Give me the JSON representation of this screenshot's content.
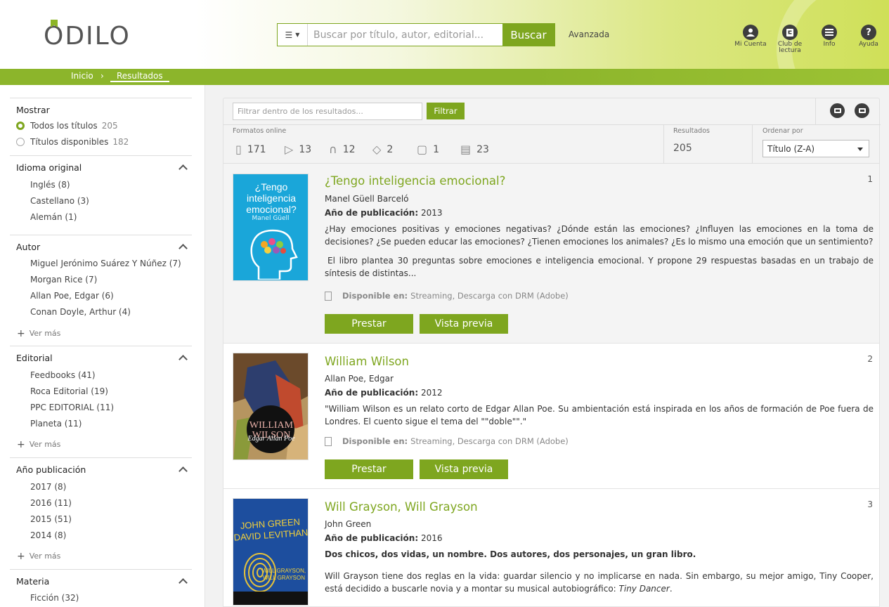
{
  "header": {
    "logo": "ODILO",
    "search": {
      "filter_icon": "list-icon",
      "placeholder": "Buscar por título, autor, editorial...",
      "button": "Buscar"
    },
    "advanced": "Avanzada",
    "icons": [
      {
        "label": "Mi Cuenta",
        "icon": "user-icon"
      },
      {
        "label": "Club de lectura",
        "icon": "club-icon"
      },
      {
        "label": "Info",
        "icon": "menu-icon"
      },
      {
        "label": "Ayuda",
        "icon": "help-icon"
      }
    ]
  },
  "breadcrumb": {
    "home": "Inicio",
    "separator": "›",
    "current": "Resultados"
  },
  "sidebar": {
    "mostrar": {
      "title": "Mostrar",
      "options": [
        {
          "label": "Todos los títulos",
          "count": "205",
          "selected": true
        },
        {
          "label": "Títulos disponibles",
          "count": "182",
          "selected": false
        }
      ]
    },
    "idioma": {
      "title": "Idioma original",
      "items": [
        "Inglés (8)",
        "Castellano (3)",
        "Alemán (1)"
      ]
    },
    "autor": {
      "title": "Autor",
      "items": [
        "Miguel Jerónimo Suárez Y Núñez (7)",
        "Morgan Rice (7)",
        "Allan Poe, Edgar (6)",
        "Conan Doyle, Arthur (4)"
      ],
      "more": "Ver más"
    },
    "editorial": {
      "title": "Editorial",
      "items": [
        "Feedbooks (41)",
        "Roca Editorial (19)",
        "PPC EDITORIAL (11)",
        "Planeta (11)"
      ],
      "more": "Ver más"
    },
    "anio": {
      "title": "Año publicación",
      "items": [
        "2017 (8)",
        "2016 (11)",
        "2015 (51)",
        "2014 (8)"
      ],
      "more": "Ver más"
    },
    "materia": {
      "title": "Materia",
      "items": [
        "Ficción (32)"
      ]
    }
  },
  "toolbar": {
    "filter_placeholder": "Filtrar dentro de los resultados...",
    "filter_button": "Filtrar",
    "formats_label": "Formatos online",
    "formats": [
      {
        "icon": "ebook-icon",
        "count": "171"
      },
      {
        "icon": "video-icon",
        "count": "13"
      },
      {
        "icon": "audio-icon",
        "count": "12"
      },
      {
        "icon": "elearning-icon",
        "count": "2"
      },
      {
        "icon": "image-icon",
        "count": "1"
      },
      {
        "icon": "document-icon",
        "count": "23"
      }
    ],
    "results_label": "Resultados",
    "results_count": "205",
    "order_label": "Ordenar por",
    "order_value": "Título (Z-A)",
    "action_icons": [
      "save-icon",
      "print-icon"
    ]
  },
  "results": [
    {
      "num": "1",
      "title": "¿Tengo inteligencia emocional?",
      "author": "Manel Güell Barceló",
      "year_label": "Año de publicación:",
      "year": "2013",
      "desc1": "¿Hay emociones positivas y emociones negativas? ¿Dónde están las emociones? ¿Influyen las emociones en la toma de decisiones? ¿Se pueden educar las emociones? ¿Tienen emociones los animales? ¿Es lo mismo una emoción que un sentimiento?",
      "desc2": "El libro plantea 30 preguntas sobre emociones e inteligencia emocional. Y propone 29 respuestas basadas en un trabajo de síntesis de distintas...",
      "avail_label": "Disponible en:",
      "avail": "Streaming, Descarga con DRM (Adobe)",
      "btn1": "Prestar",
      "btn2": "Vista previa",
      "cover": {
        "title": "¿Tengo inteligencia emocional?",
        "author": "Manel Güell"
      }
    },
    {
      "num": "2",
      "title": "William Wilson",
      "author": "Allan Poe, Edgar",
      "year_label": "Año de publicación:",
      "year": "2012",
      "desc1": "\"William Wilson es un relato corto de Edgar Allan Poe. Su ambientación está inspirada en los años de formación de Poe fuera de Londres. El cuento sigue el tema del \"\"doble\"\".\"",
      "avail_label": "Disponible en:",
      "avail": "Streaming, Descarga con DRM (Adobe)",
      "btn1": "Prestar",
      "btn2": "Vista previa",
      "cover": {
        "title": "WILLIAM WILSON",
        "author": "Edgar Allan Poe"
      }
    },
    {
      "num": "3",
      "title": "Will Grayson, Will Grayson",
      "author": "John Green",
      "year_label": "Año de publicación:",
      "year": "2016",
      "tagline": "Dos chicos, dos vidas, un nombre. Dos autores, dos personajes, un gran libro.",
      "desc1": "Will Grayson tiene dos reglas en la vida: guardar silencio y no implicarse en nada. Sin embargo, su mejor amigo, Tiny Cooper, está decidido a buscarle novia y a montar su musical autobiográfico:",
      "desc1_em": "Tiny Dancer",
      "cover": {
        "line1": "JOHN GREEN",
        "line2": "DAVID LEVITHAN",
        "line3": "WILL GRAYSON, WILL GRAYSON"
      }
    }
  ],
  "colors": {
    "accent": "#7ea61f",
    "bar": "#8cb52b"
  }
}
